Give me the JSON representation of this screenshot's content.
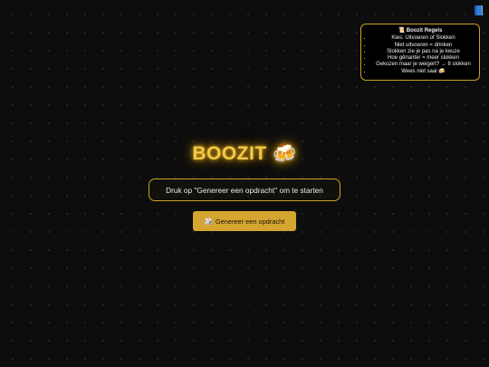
{
  "rules": {
    "title": "📜 Boozit Regels",
    "items": [
      "Kies: Uitvoeren of Slokken",
      "Niet uitvoeren = drinken",
      "Slokken zie je pas na je keuze",
      "Hoe gênanter = meer slokken",
      "Gekozen maar je weigert? → 8 slokken",
      "Wees niet saai 🍻"
    ]
  },
  "main": {
    "title": "BOOZIT 🍻",
    "prompt": "Druk op \"Genereer een opdracht\" om te starten",
    "generate_icon": "🎲",
    "generate_label": "Genereer een opdracht"
  },
  "icons": {
    "book": "book-icon"
  },
  "colors": {
    "accent": "#d4a530",
    "border": "#c9a227",
    "title": "#f3c94a",
    "background": "#0d0d0d",
    "book": "#2f7fd6"
  }
}
